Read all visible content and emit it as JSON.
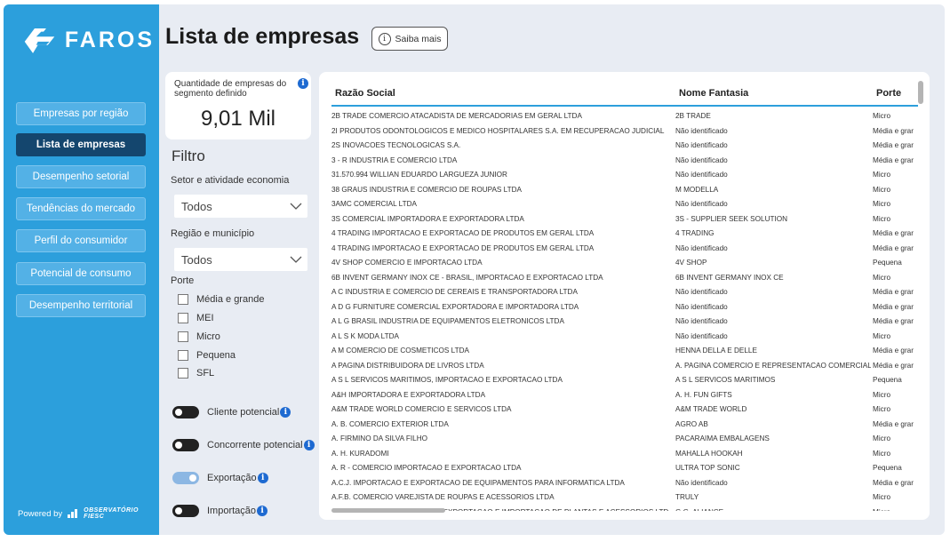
{
  "sidebar": {
    "logo_text": "FAROS",
    "nav": [
      {
        "label": "Empresas por região",
        "active": false
      },
      {
        "label": "Lista de empresas",
        "active": true
      },
      {
        "label": "Desempenho setorial",
        "active": false
      },
      {
        "label": "Tendências do mercado",
        "active": false
      },
      {
        "label": "Perfil do consumidor",
        "active": false
      },
      {
        "label": "Potencial de consumo",
        "active": false
      },
      {
        "label": "Desempenho territorial",
        "active": false
      }
    ],
    "powered_by": "Powered by",
    "powered_logo_line1": "OBSERVATÓRIO",
    "powered_logo_line2": "FIESC"
  },
  "header": {
    "title": "Lista de empresas",
    "saiba_mais": "Saiba mais"
  },
  "kpi": {
    "label": "Quantidade de empresas do segmento definido",
    "value": "9,01 Mil"
  },
  "filter": {
    "title": "Filtro",
    "setor_label": "Setor e atividade economia",
    "setor_value": "Todos",
    "regiao_label": "Região e município",
    "regiao_value": "Todos",
    "porte_label": "Porte",
    "porte_options": [
      "Média e grande",
      "MEI",
      "Micro",
      "Pequena",
      "SFL"
    ],
    "toggles": [
      {
        "label": "Cliente potencial",
        "on": false
      },
      {
        "label": "Concorrente potencial",
        "on": false
      },
      {
        "label": "Exportação",
        "on": true
      },
      {
        "label": "Importação",
        "on": false
      }
    ]
  },
  "table": {
    "headers": [
      "Razão Social",
      "Nome Fantasia",
      "Porte"
    ],
    "rows": [
      [
        "2B TRADE COMERCIO ATACADISTA DE MERCADORIAS EM GERAL LTDA",
        "2B TRADE",
        "Micro"
      ],
      [
        "2I PRODUTOS ODONTOLOGICOS E MEDICO HOSPITALARES S.A. EM RECUPERACAO JUDICIAL",
        "Não identificado",
        "Média e grar"
      ],
      [
        "2S INOVACOES TECNOLOGICAS S.A.",
        "Não identificado",
        "Média e grar"
      ],
      [
        "3 - R INDUSTRIA E COMERCIO LTDA",
        "Não identificado",
        "Média e grar"
      ],
      [
        "31.570.994 WILLIAN EDUARDO LARGUEZA JUNIOR",
        "Não identificado",
        "Micro"
      ],
      [
        "38 GRAUS INDUSTRIA E COMERCIO DE ROUPAS LTDA",
        "M MODELLA",
        "Micro"
      ],
      [
        "3AMC COMERCIAL LTDA",
        "Não identificado",
        "Micro"
      ],
      [
        "3S COMERCIAL IMPORTADORA E EXPORTADORA LTDA",
        "3S - SUPPLIER SEEK SOLUTION",
        "Micro"
      ],
      [
        "4 TRADING IMPORTACAO E EXPORTACAO DE PRODUTOS EM GERAL LTDA",
        "4 TRADING",
        "Média e grar"
      ],
      [
        "4 TRADING IMPORTACAO E EXPORTACAO DE PRODUTOS EM GERAL LTDA",
        "Não identificado",
        "Média e grar"
      ],
      [
        "4V SHOP COMERCIO E IMPORTACAO LTDA",
        "4V SHOP",
        "Pequena"
      ],
      [
        "6B INVENT GERMANY INOX CE - BRASIL, IMPORTACAO E EXPORTACAO LTDA",
        "6B INVENT GERMANY INOX CE",
        "Micro"
      ],
      [
        "A C INDUSTRIA E COMERCIO DE CEREAIS E TRANSPORTADORA LTDA",
        "Não identificado",
        "Média e grar"
      ],
      [
        "A D G FURNITURE COMERCIAL EXPORTADORA E IMPORTADORA LTDA",
        "Não identificado",
        "Média e grar"
      ],
      [
        "A L G BRASIL INDUSTRIA DE EQUIPAMENTOS ELETRONICOS LTDA",
        "Não identificado",
        "Média e grar"
      ],
      [
        "A L S K MODA LTDA",
        "Não identificado",
        "Micro"
      ],
      [
        "A M COMERCIO DE COSMETICOS LTDA",
        "HENNA DELLA E DELLE",
        "Média e grar"
      ],
      [
        "A PAGINA DISTRIBUIDORA DE LIVROS LTDA",
        "A. PAGINA COMERCIO E REPRESENTACAO COMERCIAL",
        "Média e grar"
      ],
      [
        "A S L SERVICOS MARITIMOS, IMPORTACAO E EXPORTACAO LTDA",
        "A S L SERVICOS MARITIMOS",
        "Pequena"
      ],
      [
        "A&H IMPORTADORA E EXPORTADORA LTDA",
        "A. H. FUN GIFTS",
        "Micro"
      ],
      [
        "A&M TRADE WORLD COMERCIO E SERVICOS LTDA",
        "A&M TRADE WORLD",
        "Micro"
      ],
      [
        "A. B. COMERCIO EXTERIOR LTDA",
        "AGRO AB",
        "Média e grar"
      ],
      [
        "A. FIRMINO DA SILVA FILHO",
        "PACARAIMA EMBALAGENS",
        "Micro"
      ],
      [
        "A. H. KURADOMI",
        "MAHALLA HOOKAH",
        "Micro"
      ],
      [
        "A. R - COMERCIO IMPORTACAO E EXPORTACAO LTDA",
        "ULTRA TOP SONIC",
        "Pequena"
      ],
      [
        "A.C.J. IMPORTACAO E EXPORTACAO DE EQUIPAMENTOS PARA INFORMATICA LTDA",
        "Não identificado",
        "Média e grar"
      ],
      [
        "A.F.B. COMERCIO VAREJISTA DE ROUPAS E ACESSORIOS LTDA",
        "TRULY",
        "Micro"
      ],
      [
        "A.G.G. INDUSTRIA, COMERCIO, EXPORTACAO E IMPORTACAO DE PLANTAS E ACESSORIOS LTDA",
        "G.G. ALIANCE",
        "Micro"
      ]
    ]
  }
}
